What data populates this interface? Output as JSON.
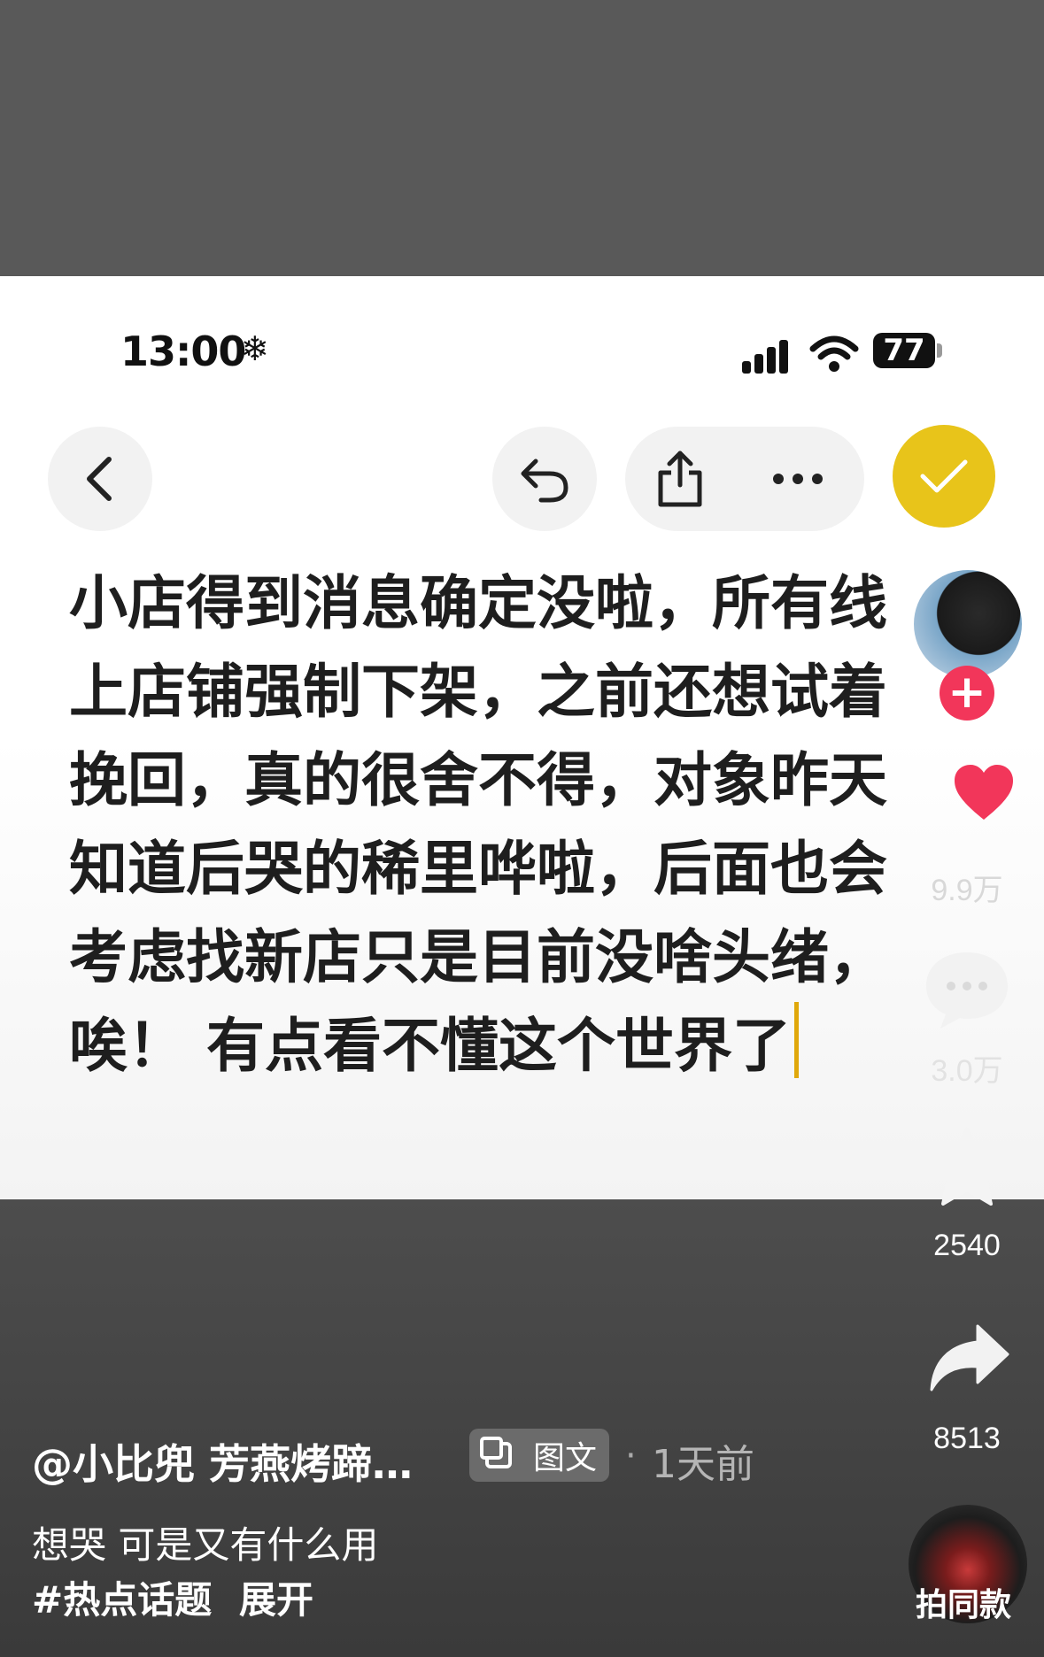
{
  "status_bar": {
    "time": "13:00",
    "extra_icon": "❄",
    "battery": "77"
  },
  "toolbar": {
    "back_icon": "chevron-left-icon",
    "undo_icon": "undo-icon",
    "share_icon": "share-icon",
    "more_icon": "more-icon",
    "done_icon": "check-icon",
    "done_color": "#e8c41a"
  },
  "editor": {
    "lines": [
      "小店得到消息确定没啦，所有线",
      "上店铺强制下架，之前还想试着",
      "挽回，真的很舍不得，对象昨天",
      "知道后哭的稀里哗啦，后面也会",
      "考虑找新店只是目前没啥头绪，",
      "唉！ 有点看不懂这个世界了"
    ]
  },
  "rail": {
    "like_count": "9.9万",
    "comment_count": "3.0万",
    "favorite_count": "2540",
    "share_count": "8513",
    "like_color": "#f2365a"
  },
  "post": {
    "author": "@小比兜 芳燕烤蹄…",
    "tag": "图文",
    "separator": "·",
    "time_ago": "1天前",
    "caption": "想哭 可是又有什么用",
    "hashtag": "#热点话题",
    "expand": "展开",
    "music_label": "拍同款"
  }
}
